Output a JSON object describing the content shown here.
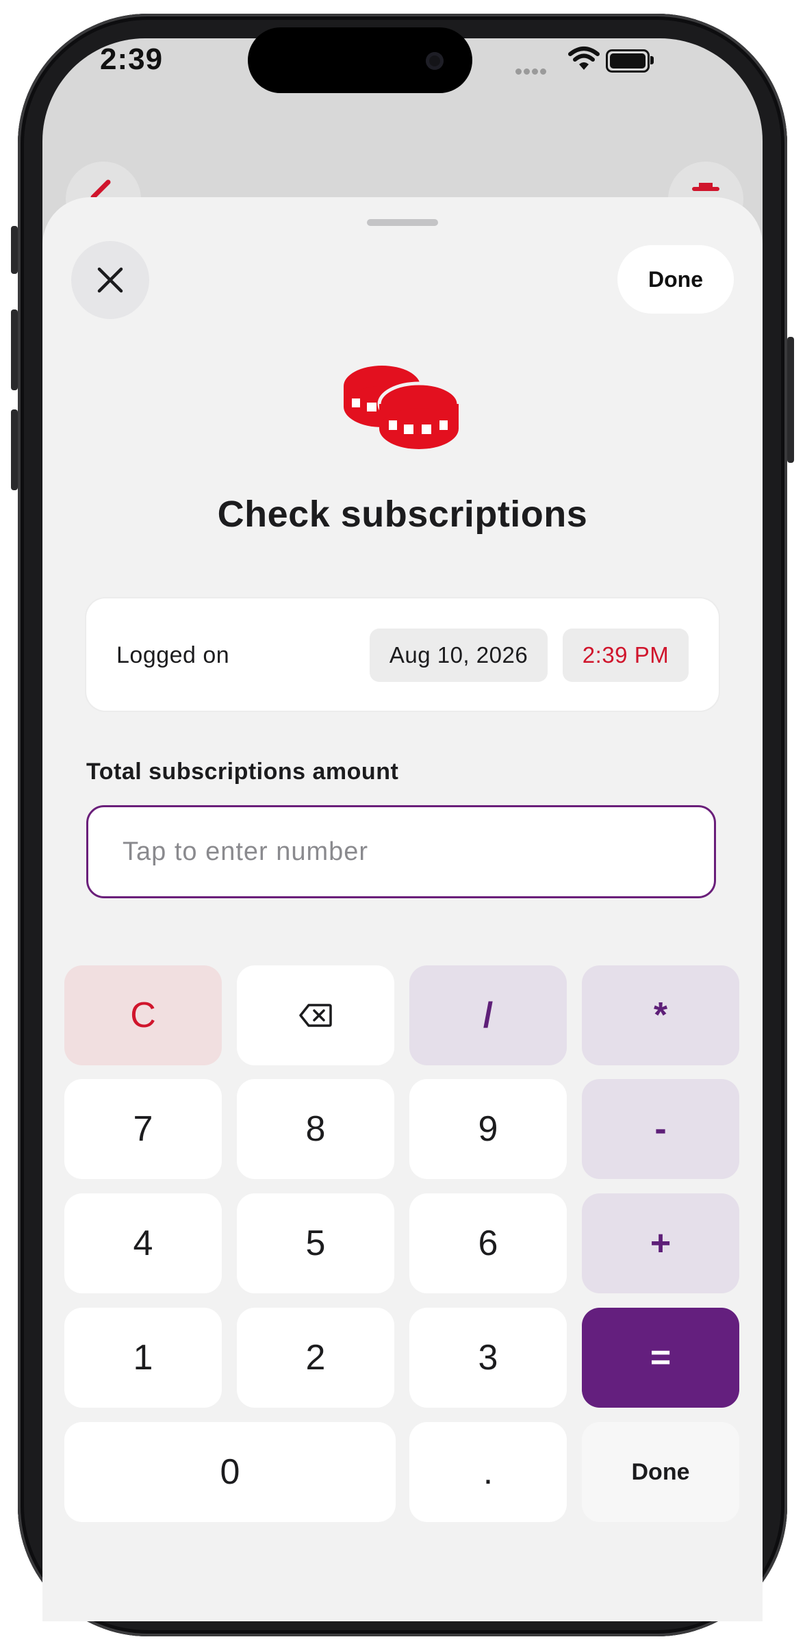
{
  "status_bar": {
    "time": "2:39"
  },
  "sheet": {
    "done_label": "Done",
    "title": "Check subscriptions",
    "logged": {
      "label": "Logged on",
      "date": "Aug 10, 2026",
      "time": "2:39 PM"
    },
    "amount": {
      "label": "Total subscriptions amount",
      "placeholder": "Tap to enter number",
      "value": ""
    }
  },
  "keypad": {
    "clear": "C",
    "divide": "/",
    "multiply": "*",
    "minus": "-",
    "plus": "+",
    "equals": "=",
    "dot": ".",
    "done": "Done",
    "digits": {
      "d0": "0",
      "d1": "1",
      "d2": "2",
      "d3": "3",
      "d4": "4",
      "d5": "5",
      "d6": "6",
      "d7": "7",
      "d8": "8",
      "d9": "9"
    }
  },
  "icons": [
    "close-icon",
    "coins-icon",
    "backspace-icon",
    "wifi-icon",
    "battery-icon",
    "chevron-left-icon",
    "trash-icon"
  ],
  "colors": {
    "accent_purple": "#641f7e",
    "accent_red": "#d0152c",
    "sheet_bg": "#f2f2f2"
  }
}
